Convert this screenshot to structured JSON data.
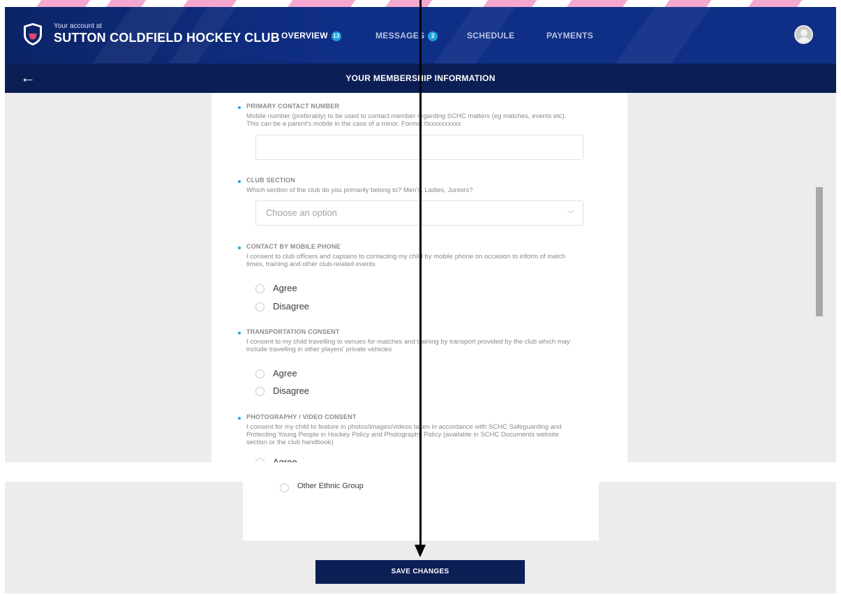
{
  "header": {
    "account_prefix": "Your account at",
    "club_name": "SUTTON COLDFIELD HOCKEY CLUB",
    "nav": [
      {
        "label": "OVERVIEW",
        "badge": "13"
      },
      {
        "label": "MESSAGES",
        "badge": "2"
      },
      {
        "label": "SCHEDULE"
      },
      {
        "label": "PAYMENTS"
      }
    ]
  },
  "subbar": {
    "title": "YOUR MEMBERSHIP INFORMATION"
  },
  "form": {
    "primary_contact": {
      "label": "PRIMARY CONTACT NUMBER",
      "description": "Mobile number (preferably) to be used to contact member regarding SCHC matters (eg matches, events etc). This can be a parent's mobile in the case of a minor. Format 0xxxxxxxxxx",
      "value": ""
    },
    "club_section": {
      "label": "CLUB SECTION",
      "description": "Which section of the club do you primarily belong to? Men's, Ladies, Juniors?",
      "placeholder": "Choose an option"
    },
    "contact_by_mobile": {
      "label": "CONTACT BY MOBILE PHONE",
      "description": "I consent to club officers and captains to contacting my child by mobile phone on occasion to inform of match times, training and other club-related events",
      "options": [
        "Agree",
        "Disagree"
      ]
    },
    "transportation": {
      "label": "TRANSPORTATION CONSENT",
      "description": "I consent to my child travelling to venues for matches and training by transport provided by the club which may include travelling in other players' private vehicles",
      "options": [
        "Agree",
        "Disagree"
      ]
    },
    "photography": {
      "label": "PHOTOGRAPHY / VIDEO CONSENT",
      "description": "I consent for my child to feature in photos/images/videos taken in accordance with SCHC Safeguarding and Protecting Young People in Hockey Policy and Photography Policy (available in SCHC Documents website section or the club handbook)",
      "options": [
        "Agree"
      ]
    },
    "ethnicity_option": "Other Ethnic Group",
    "save_label": "SAVE CHANGES"
  },
  "colors": {
    "header_navy": "#0f2f86",
    "subbar_navy": "#0c1f55",
    "accent_blue": "#1fa3e0",
    "decor_pink": "#f4a8d0"
  },
  "icons": {
    "back": "←",
    "chevron": "﹀"
  }
}
